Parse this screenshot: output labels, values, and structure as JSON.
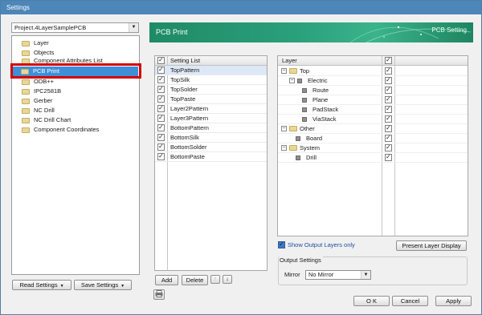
{
  "window": {
    "title": "Settings"
  },
  "project_select": {
    "value": "Project.4LayerSamplePCB"
  },
  "tree": {
    "items": [
      {
        "label": "Layer"
      },
      {
        "label": "Objects"
      },
      {
        "label": "Component Attributes List"
      },
      {
        "label": "PCB Print"
      },
      {
        "label": "ODB++"
      },
      {
        "label": "IPC2581B"
      },
      {
        "label": "Gerber"
      },
      {
        "label": "NC Drill"
      },
      {
        "label": "NC Drill Chart"
      },
      {
        "label": "Component Coordinates"
      }
    ]
  },
  "left_buttons": {
    "read": "Read Settings",
    "save": "Save Settings"
  },
  "header": {
    "title": "PCB Print",
    "subtitle": "PCB Setting"
  },
  "setting_list": {
    "header": "Setting List",
    "rows": [
      {
        "label": "TopPattern",
        "checked": true
      },
      {
        "label": "TopSilk",
        "checked": true
      },
      {
        "label": "TopSolder",
        "checked": true
      },
      {
        "label": "TopPaste",
        "checked": true
      },
      {
        "label": "Layer2Pattern",
        "checked": true
      },
      {
        "label": "Layer3Pattern",
        "checked": true
      },
      {
        "label": "BottomPattern",
        "checked": true
      },
      {
        "label": "BottomSilk",
        "checked": true
      },
      {
        "label": "BottomSolder",
        "checked": true
      },
      {
        "label": "BottomPaste",
        "checked": true
      }
    ],
    "add": "Add",
    "delete": "Delete"
  },
  "layer_tree": {
    "header": "Layer",
    "rows": [
      {
        "label": "Top"
      },
      {
        "label": "Electric"
      },
      {
        "label": "Route"
      },
      {
        "label": "Plane"
      },
      {
        "label": "PadStack"
      },
      {
        "label": "ViaStack"
      },
      {
        "label": "Other"
      },
      {
        "label": "Board"
      },
      {
        "label": "System"
      },
      {
        "label": "Drill"
      }
    ]
  },
  "show_output": {
    "label": "Show Output Layers only",
    "checked": true
  },
  "present_layer_display": "Present Layer Display",
  "output_settings": {
    "label": "Output Settings",
    "mirror_label": "Mirror",
    "mirror_value": "No Mirror"
  },
  "footer": {
    "ok": "O K",
    "cancel": "Cancel",
    "apply": "Apply"
  }
}
